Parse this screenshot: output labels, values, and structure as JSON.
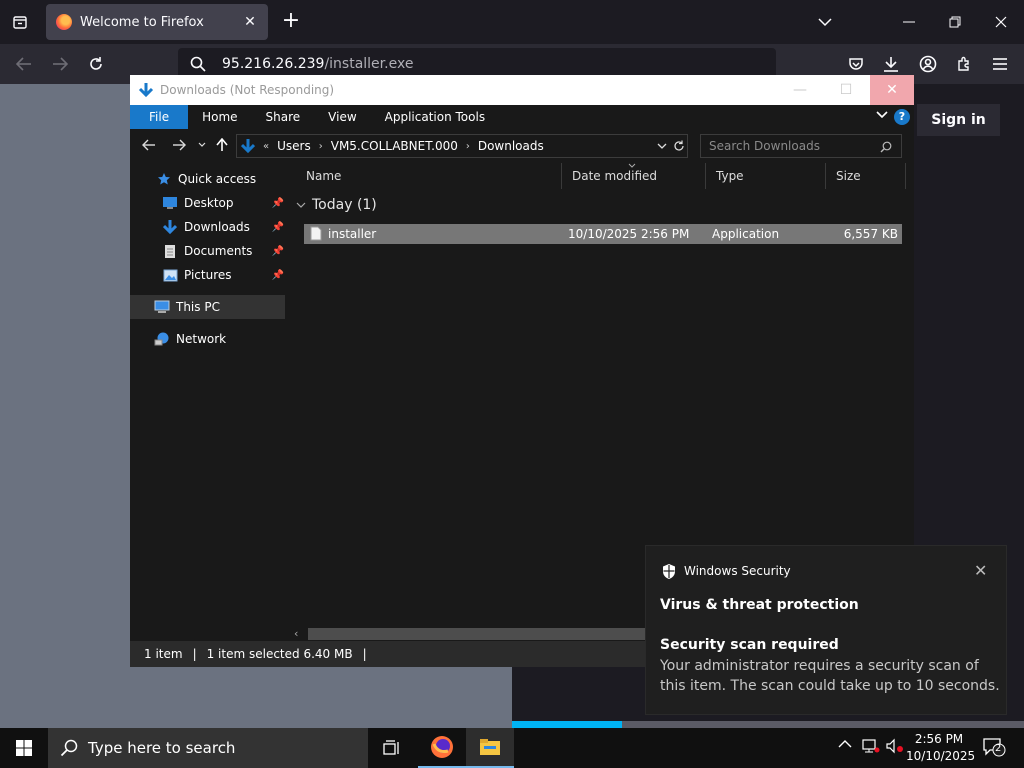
{
  "browser": {
    "tab_title": "Welcome to Firefox",
    "url_host": "95.216.26.239",
    "url_path": "/installer.exe",
    "sign_in_label": "Sign in",
    "download_progress": 0.215
  },
  "explorer": {
    "window_title": "Downloads (Not Responding)",
    "ribbon_tabs": [
      "File",
      "Home",
      "Share",
      "View",
      "Application Tools"
    ],
    "breadcrumb": [
      "Users",
      "VM5.COLLABNET.000",
      "Downloads"
    ],
    "search_placeholder": "Search Downloads",
    "nav": {
      "quick_access": "Quick access",
      "desktop": "Desktop",
      "downloads": "Downloads",
      "documents": "Documents",
      "pictures": "Pictures",
      "this_pc": "This PC",
      "network": "Network"
    },
    "columns": [
      "Name",
      "Date modified",
      "Type",
      "Size"
    ],
    "group_label": "Today (1)",
    "files": [
      {
        "name": "installer",
        "date": "10/10/2025 2:56 PM",
        "type": "Application",
        "size": "6,557 KB"
      }
    ],
    "status": {
      "count": "1 item",
      "selection": "1 item selected  6.40 MB"
    }
  },
  "toast": {
    "app_name": "Windows Security",
    "heading": "Virus & threat protection",
    "subheading": "Security scan required",
    "body": "Your administrator requires a security scan of this item. The scan could take up to 10 seconds."
  },
  "taskbar": {
    "search_placeholder": "Type here to search",
    "time": "2:56 PM",
    "date": "10/10/2025",
    "notification_count": "2"
  },
  "colors": {
    "accent_blue": "#1979ca",
    "firefox_dark": "#1c1b22",
    "progress_blue": "#00b3f4"
  }
}
